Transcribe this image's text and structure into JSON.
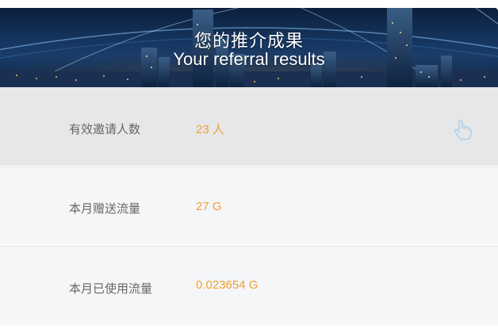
{
  "banner": {
    "title_cn": "您的推介成果",
    "title_en": "Your referral results"
  },
  "rows": [
    {
      "label": "有效邀请人数",
      "value": "23 人"
    },
    {
      "label": "本月赠送流量",
      "value": "27 G"
    },
    {
      "label": "本月已使用流量",
      "value": "0.023654 G"
    }
  ],
  "colors": {
    "value_accent": "#f0a030",
    "label_text": "#666666",
    "row_highlight": "#e6e7e8",
    "row_bg": "#f5f6f8"
  },
  "icons": {
    "pointer": "hand-pointer-icon"
  }
}
